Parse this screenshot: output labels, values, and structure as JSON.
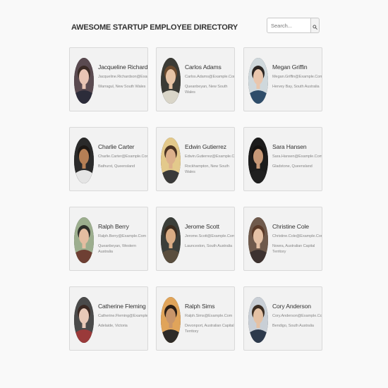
{
  "header": {
    "title": "Awesome Startup Employee Directory"
  },
  "search": {
    "placeholder": "Search...",
    "icon": "search-icon"
  },
  "employees": [
    {
      "name": "Jacqueline Richardson",
      "email": "Jacqueline.Richardson@Example.Com",
      "location": "Warragul, New South Wales",
      "palette": {
        "skin": "#e8c4b4",
        "hair": "#3a2a25",
        "bg": "#5a4a50",
        "shirt": "#2c2c3a"
      }
    },
    {
      "name": "Carlos Adams",
      "email": "Carlos.Adams@Example.Com",
      "location": "Queanbeyan, New South Wales",
      "palette": {
        "skin": "#e6c3a5",
        "hair": "#6b4a2e",
        "bg": "#3b3b36",
        "shirt": "#d9d5c8"
      }
    },
    {
      "name": "Megan Griffin",
      "email": "Megan.Griffin@Example.Com",
      "location": "Hervey Bay, South Australia",
      "palette": {
        "skin": "#e9c6ad",
        "hair": "#2a2522",
        "bg": "#cfd8dc",
        "shirt": "#2f4d6a"
      }
    },
    {
      "name": "Charlie Carter",
      "email": "Charlie.Carter@Example.Com",
      "location": "Bathurst, Queensland",
      "palette": {
        "skin": "#b57f55",
        "hair": "#1d1815",
        "bg": "#2a2a2a",
        "shirt": "#e5e5e5"
      }
    },
    {
      "name": "Edwin Gutierrez",
      "email": "Edwin.Gutierrez@Example.Com",
      "location": "Rockhampton, New South Wales",
      "palette": {
        "skin": "#dcb08b",
        "hair": "#4a3323",
        "bg": "#e3c98b",
        "shirt": "#3a3a3a"
      }
    },
    {
      "name": "Sara Hansen",
      "email": "Sara.Hansen@Example.Com",
      "location": "Gladstone, Queensland",
      "palette": {
        "skin": "#c69877",
        "hair": "#161311",
        "bg": "#1c1c1c",
        "shirt": "#202020"
      }
    },
    {
      "name": "Ralph Berry",
      "email": "Ralph.Berry@Example.Com",
      "location": "Queanbeyan, Western Australia",
      "palette": {
        "skin": "#e4bda1",
        "hair": "#2e2f2a",
        "bg": "#9cae8e",
        "shirt": "#6e3f33"
      }
    },
    {
      "name": "Jerome Scott",
      "email": "Jerome.Scott@Example.Com",
      "location": "Launceston, South Australia",
      "palette": {
        "skin": "#d8ac84",
        "hair": "#3a2b1e",
        "bg": "#3b3f3a",
        "shirt": "#5a4e3e"
      }
    },
    {
      "name": "Christine Cole",
      "email": "Christine.Cole@Example.Com",
      "location": "Nowra, Australian Capital Territory",
      "palette": {
        "skin": "#e5c2a6",
        "hair": "#5a3a28",
        "bg": "#6f5a4c",
        "shirt": "#3d3230"
      }
    },
    {
      "name": "Catherine Fleming",
      "email": "Catherine.Fleming@Example.Com",
      "location": "Adelaide, Victoria",
      "palette": {
        "skin": "#e8c9b8",
        "hair": "#3a2822",
        "bg": "#4a4a4a",
        "shirt": "#9a3a3a"
      }
    },
    {
      "name": "Ralph Sims",
      "email": "Ralph.Sims@Example.Com",
      "location": "Devonport, Australian Capital Territory",
      "palette": {
        "skin": "#c8956a",
        "hair": "#2a1e16",
        "bg": "#e0a45a",
        "shirt": "#2e2b28"
      }
    },
    {
      "name": "Cory Anderson",
      "email": "Cory.Anderson@Example.Com",
      "location": "Bendigo, South Australia",
      "palette": {
        "skin": "#e4c1a4",
        "hair": "#3b2d22",
        "bg": "#c9cfd6",
        "shirt": "#2d3a4c"
      }
    }
  ]
}
